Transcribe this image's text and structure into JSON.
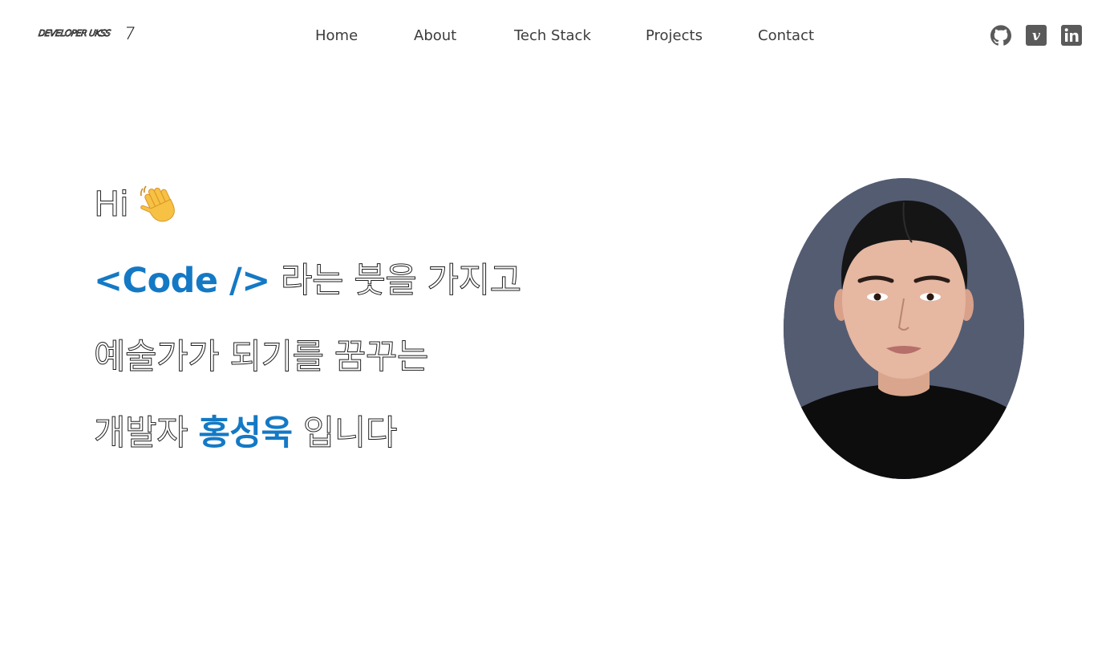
{
  "header": {
    "logo_text": "DEVELOPER UKSS",
    "nav": {
      "home": "Home",
      "about": "About",
      "tech_stack": "Tech Stack",
      "projects": "Projects",
      "contact": "Contact"
    },
    "social_icons": [
      "github-icon",
      "velog-icon",
      "linkedin-icon"
    ]
  },
  "hero": {
    "line1": "Hi",
    "line1_emoji": "waving-hand-icon",
    "line2_accent": "<Code />",
    "line2_rest": " 라는 붓을 가지고",
    "line3": "예술가가 되기를 꿈꾸는",
    "line4_prefix": "개발자 ",
    "line4_name": "홍성욱",
    "line4_suffix": " 입니다"
  },
  "colors": {
    "accent": "#1479c5",
    "nav_text": "#3c3c3c",
    "photo_background": "#545c72",
    "icon": "#5a5a5a"
  }
}
